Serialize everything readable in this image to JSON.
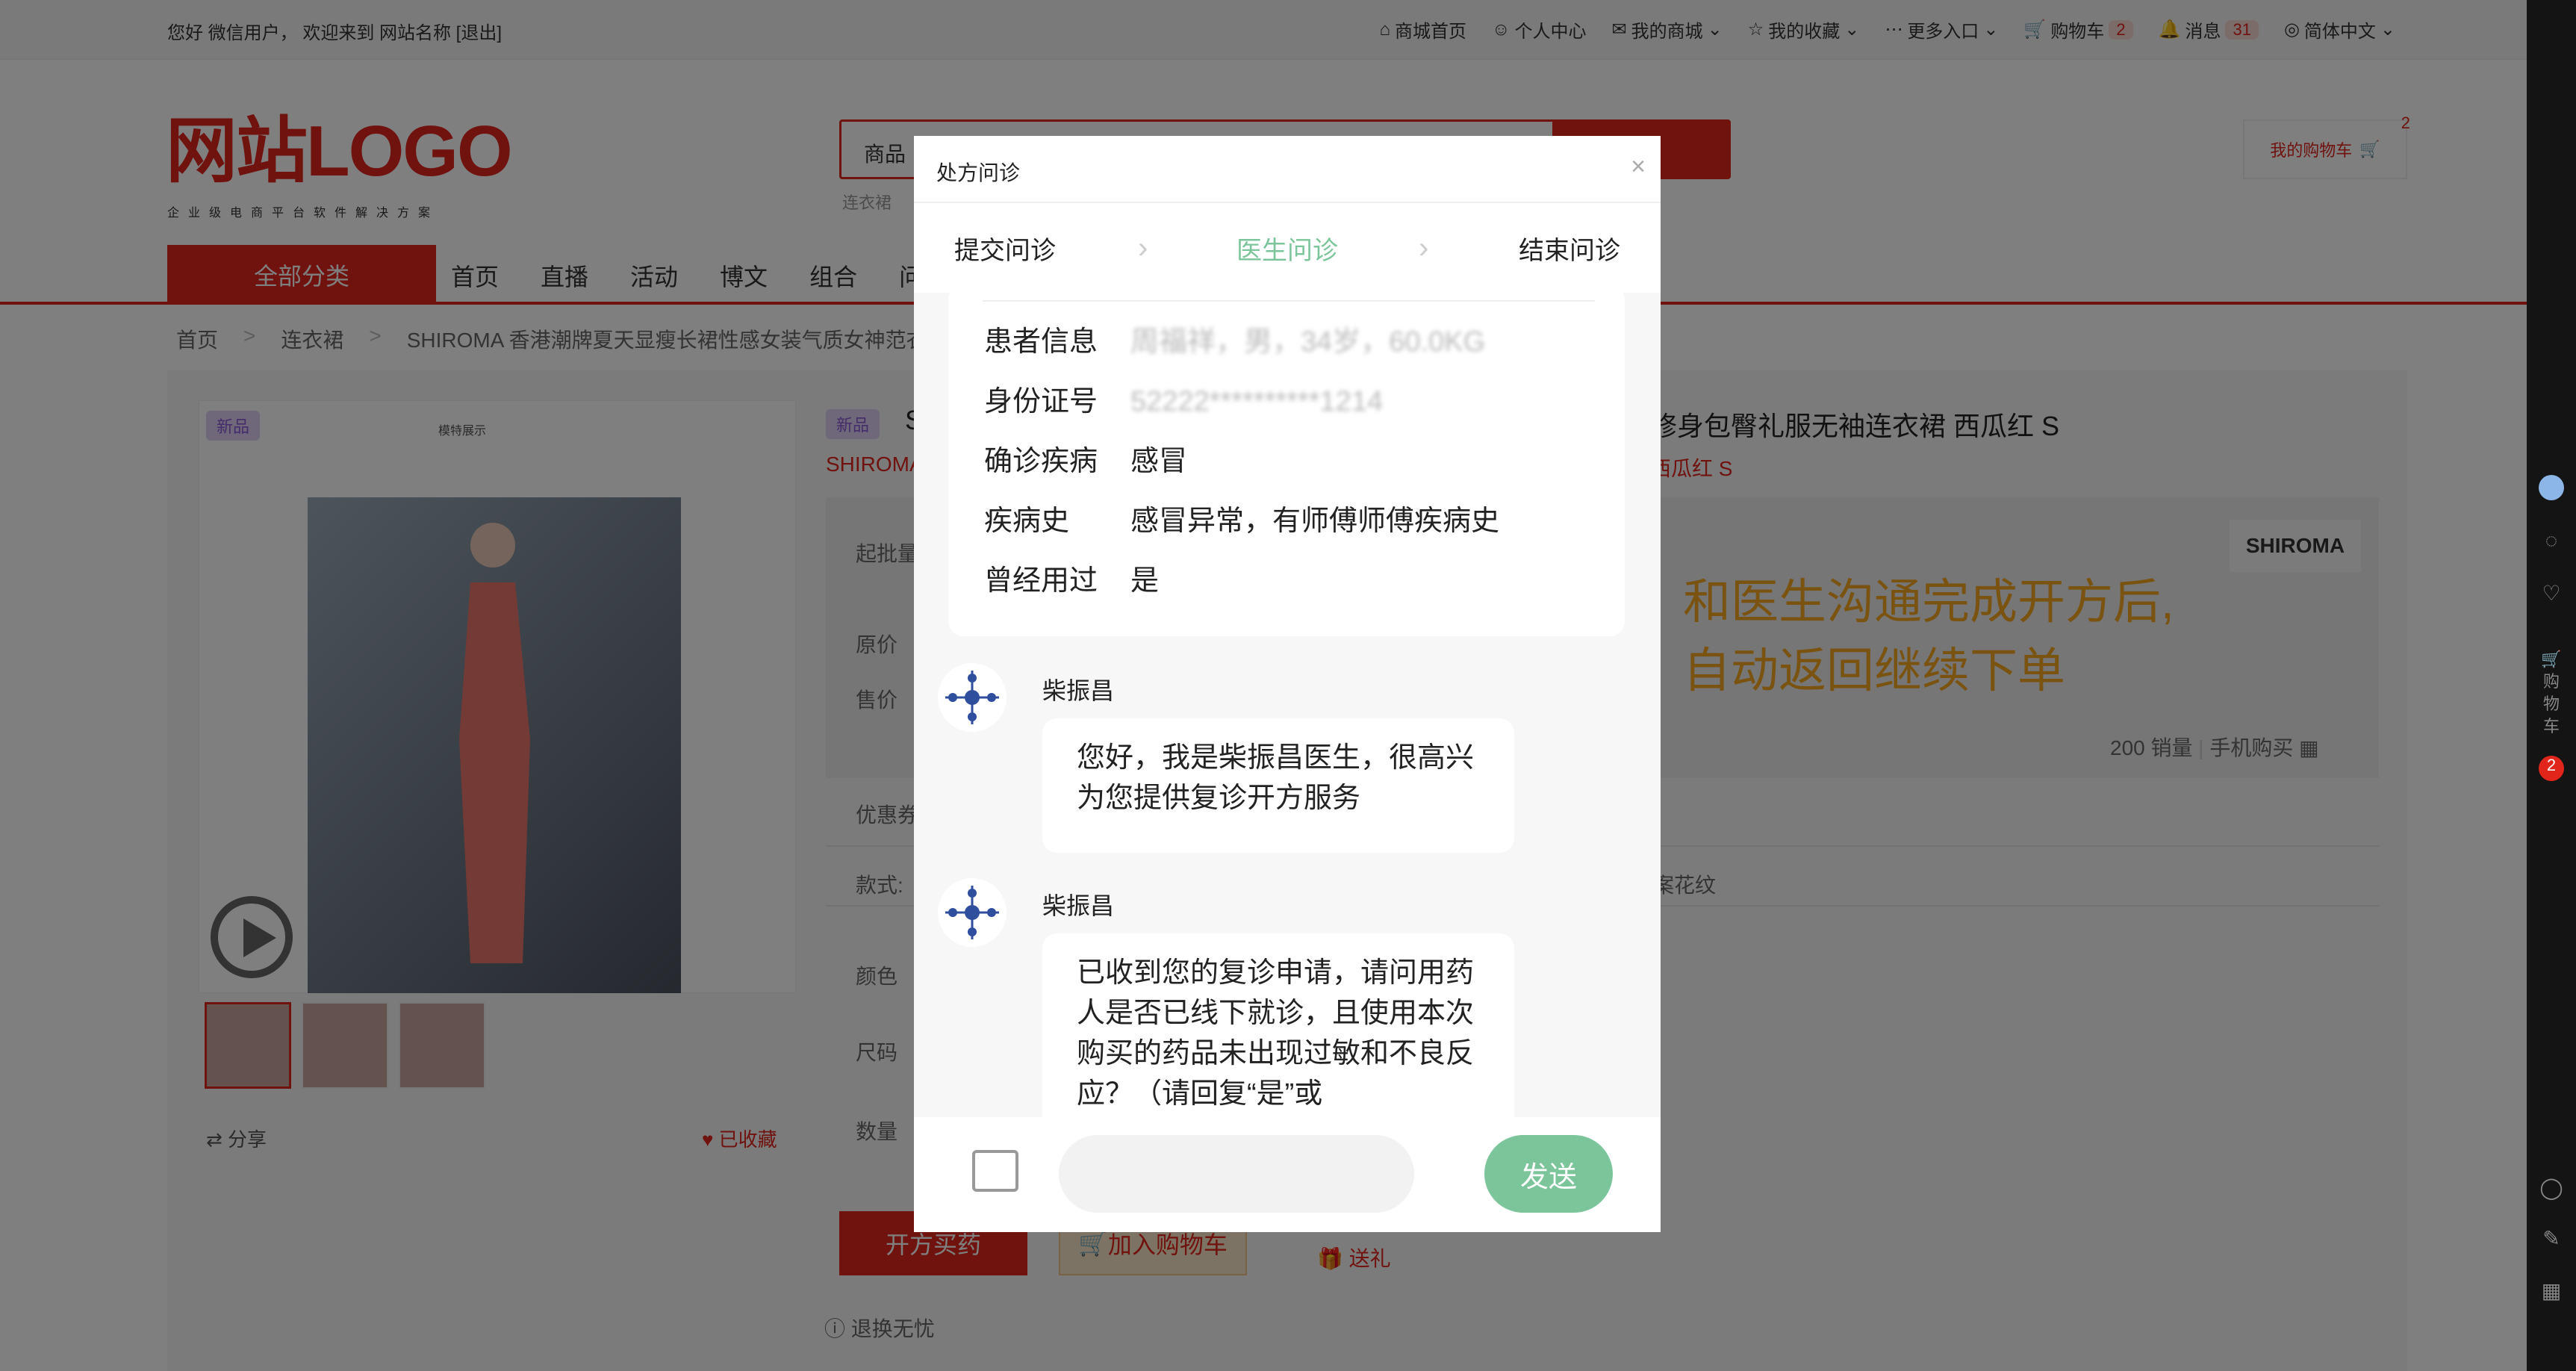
{
  "topbar": {
    "greeting": "您好 微信用户， 欢迎来到 网站名称 [退出]",
    "items": [
      "商城首页",
      "个人中心",
      "我的商城",
      "我的收藏",
      "更多入口",
      "购物车",
      "消息",
      "简体中文"
    ],
    "cart_count": "2",
    "msg_count": "31"
  },
  "header": {
    "logo": "网站LOGO",
    "logo_sub": "企业级电商平台软件解决方案",
    "search_cat": "商品",
    "hot_word": "连衣裙",
    "cart_label": "我的购物车",
    "cart_count": "2"
  },
  "nav": {
    "all_cat": "全部分类",
    "items": [
      "首页",
      "直播",
      "活动",
      "博文",
      "组合",
      "问答"
    ]
  },
  "breadcrumb": [
    "首页",
    "连衣裙",
    "SHIROMA 香港潮牌夏天显瘦长裙性感女装气质女神范衣"
  ],
  "product": {
    "new_tag": "新品",
    "title": "修身包臀礼服无袖连衣裙 西瓜红 S",
    "title_prefix": "S",
    "brand_line": "SHIROMA",
    "sub": "西瓜红 S",
    "labels": {
      "moq": "起批量",
      "orig": "原价",
      "sale": "售价",
      "coupon": "优惠券",
      "style": "款式:",
      "color": "颜色",
      "size": "尺码",
      "qty": "数量"
    },
    "brand_logo": "SHIROMA",
    "promo": [
      "和医生沟通完成开方后,",
      "自动返回继续下单"
    ],
    "sales": "200 销量",
    "mobile_buy": "手机购买",
    "style_value": "案花纹",
    "share": "分享",
    "favorited": "已收藏",
    "buy_btn": "开方买药",
    "cart_btn": "加入购物车",
    "gift": "送礼",
    "refund": "退换无忧",
    "image_caption": "模特展示"
  },
  "modal": {
    "title": "处方问诊",
    "close": "×",
    "steps": [
      "提交问诊",
      "医生问诊",
      "结束问诊"
    ],
    "active_step": 1,
    "info": [
      {
        "k": "患者信息",
        "v": "周福祥，男，34岁，60.0KG"
      },
      {
        "k": "身份证号",
        "v": "52222**********1214"
      },
      {
        "k": "确诊疾病",
        "v": "感冒"
      },
      {
        "k": "疾病史",
        "v": "感冒异常，有师傅师傅疾病史"
      },
      {
        "k": "曾经用过",
        "v": "是"
      }
    ],
    "messages": [
      {
        "name": "柴振昌",
        "text": "您好，我是柴振昌医生，很高兴为您提供复诊开方服务"
      },
      {
        "name": "柴振昌",
        "text": "已收到您的复诊申请，请问用药人是否已线下就诊，且使用本次购买的药品未出现过敏和不良反应？（请回复“是”或"
      }
    ],
    "input_placeholder": "",
    "send": "发送"
  },
  "colors": {
    "brand": "#e1251b",
    "accent": "#7cc59a",
    "promo": "#f5a623"
  }
}
